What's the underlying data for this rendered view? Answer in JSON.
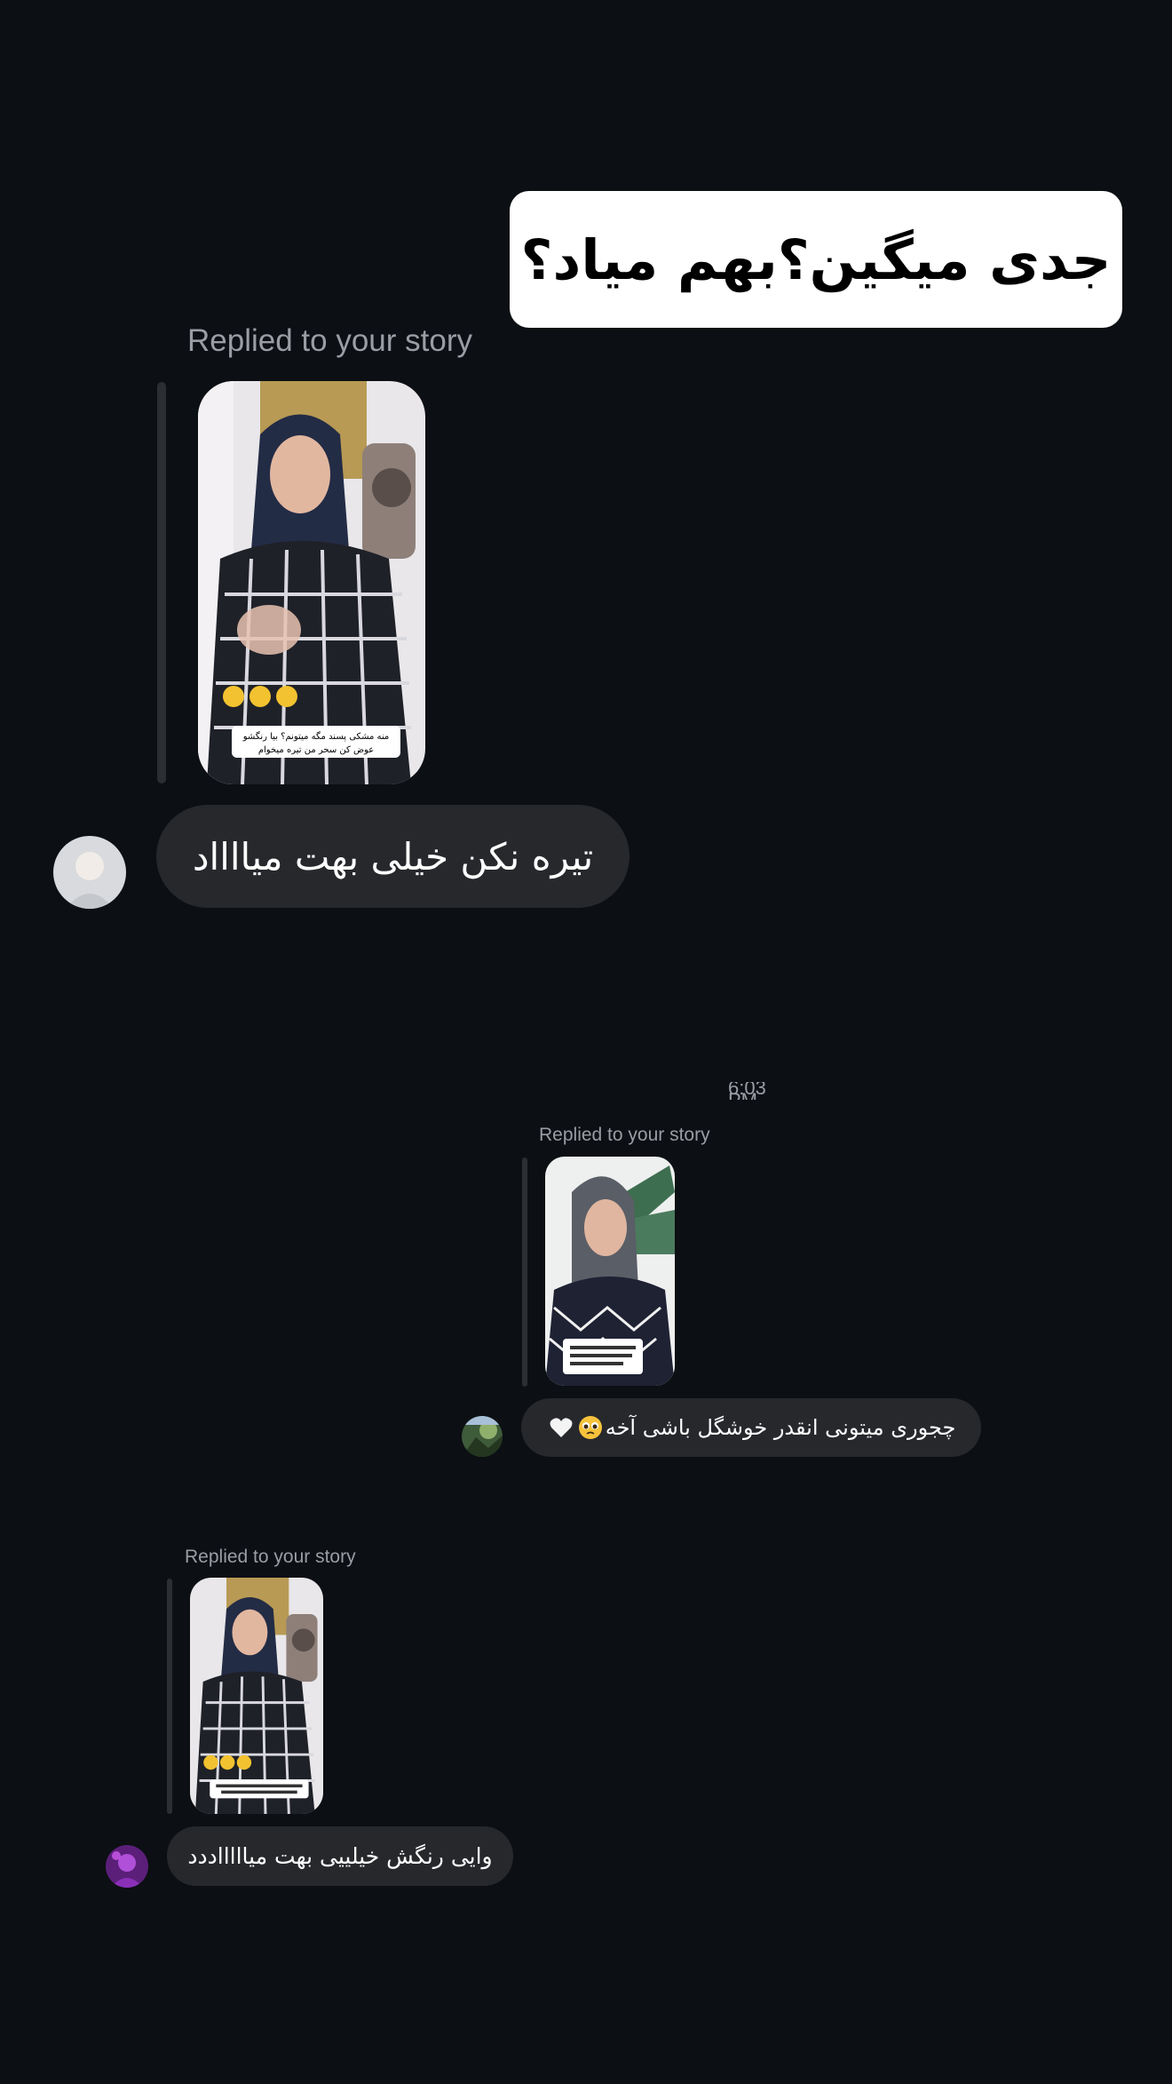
{
  "overlay": {
    "title_text": "جدی میگین؟بهم میاد؟"
  },
  "conversation": {
    "timestamp": "6:03 PM",
    "messages": [
      {
        "replied_label": "Replied to your story",
        "story_caption_line1": "منه مشکی پسند مگه میتونم؟ بیا رنگشو",
        "story_caption_line2": "عوض کن سحر من تیره میخوام",
        "text": "تیره نکن خیلی بهت میااااد",
        "avatar_icon": "avatar-light-portrait-icon"
      },
      {
        "replied_label": "Replied to your story",
        "text": "چجوری میتونی انقدر خوشگل باشی آخه",
        "emoji": [
          "pleading-face-icon",
          "white-heart-icon"
        ],
        "avatar_icon": "avatar-green-landscape-icon"
      },
      {
        "replied_label": "Replied to your story",
        "text": "وایی رنگش خیلییی بهت میاااااددد",
        "avatar_icon": "avatar-purple-portrait-icon"
      }
    ]
  },
  "colors": {
    "background": "#0c0f13",
    "bubble": "#26282c",
    "reply_bar": "#2b2e33",
    "label": "#9a9ea4",
    "title_card": "#ffffff"
  }
}
